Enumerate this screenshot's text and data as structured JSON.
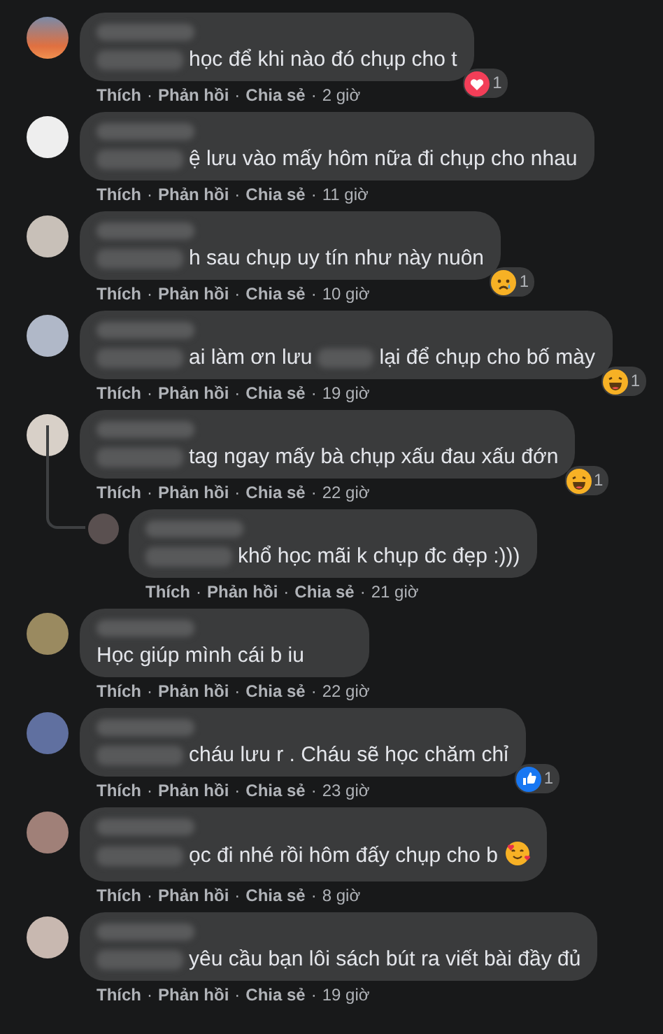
{
  "separator": "·",
  "comments": [
    {
      "segments": [
        {
          "kind": "blur"
        },
        {
          "kind": "text",
          "text": "học để khi nào đó chụp cho t"
        }
      ],
      "reaction": {
        "kind": "love",
        "count": "1"
      },
      "actions": [
        "Thích",
        "Phản hồi",
        "Chia sẻ"
      ],
      "time": "2 giờ"
    },
    {
      "segments": [
        {
          "kind": "blur"
        },
        {
          "kind": "text",
          "text": "ệ lưu vào mấy hôm nữa đi chụp cho nhau"
        }
      ],
      "actions": [
        "Thích",
        "Phản hồi",
        "Chia sẻ"
      ],
      "time": "11 giờ"
    },
    {
      "segments": [
        {
          "kind": "blur"
        },
        {
          "kind": "text",
          "text": "h sau chụp uy tín như này nuôn"
        }
      ],
      "reaction": {
        "kind": "sad",
        "count": "1"
      },
      "actions": [
        "Thích",
        "Phản hồi",
        "Chia sẻ"
      ],
      "time": "10 giờ"
    },
    {
      "segments": [
        {
          "kind": "blur"
        },
        {
          "kind": "text",
          "text": "ai làm ơn lưu"
        },
        {
          "kind": "blur"
        },
        {
          "kind": "text",
          "text": "lại để chụp cho bố mày"
        }
      ],
      "reaction": {
        "kind": "haha",
        "count": "1"
      },
      "actions": [
        "Thích",
        "Phản hồi",
        "Chia sẻ"
      ],
      "time": "19 giờ"
    },
    {
      "segments": [
        {
          "kind": "blur"
        },
        {
          "kind": "text",
          "text": "tag ngay mấy bà chụp xấu đau xấu đớn"
        }
      ],
      "reaction": {
        "kind": "haha",
        "count": "1"
      },
      "actions": [
        "Thích",
        "Phản hồi",
        "Chia sẻ"
      ],
      "time": "22 giờ",
      "replies": [
        {
          "segments": [
            {
              "kind": "blur"
            },
            {
              "kind": "text",
              "text": "khổ học mãi k chụp đc đẹp :)))"
            }
          ],
          "actions": [
            "Thích",
            "Phản hồi",
            "Chia sẻ"
          ],
          "time": "21 giờ"
        }
      ]
    },
    {
      "segments": [
        {
          "kind": "text",
          "text": "Học giúp mình cái b iu"
        }
      ],
      "actions": [
        "Thích",
        "Phản hồi",
        "Chia sẻ"
      ],
      "time": "22 giờ"
    },
    {
      "segments": [
        {
          "kind": "blur"
        },
        {
          "kind": "text",
          "text": "cháu lưu r . Cháu sẽ học chăm chỉ"
        }
      ],
      "reaction": {
        "kind": "like",
        "count": "1"
      },
      "actions": [
        "Thích",
        "Phản hồi",
        "Chia sẻ"
      ],
      "time": "23 giờ"
    },
    {
      "segments": [
        {
          "kind": "blur"
        },
        {
          "kind": "text",
          "text": "ọc đi nhé rồi hôm đấy chụp cho b"
        },
        {
          "kind": "emoji"
        }
      ],
      "actions": [
        "Thích",
        "Phản hồi",
        "Chia sẻ"
      ],
      "time": "8 giờ"
    },
    {
      "segments": [
        {
          "kind": "blur"
        },
        {
          "kind": "text",
          "text": "yêu cầu bạn lôi sách bút ra viết bài đầy đủ"
        }
      ],
      "actions": [
        "Thích",
        "Phản hồi",
        "Chia sẻ"
      ],
      "time": "19 giờ"
    }
  ]
}
